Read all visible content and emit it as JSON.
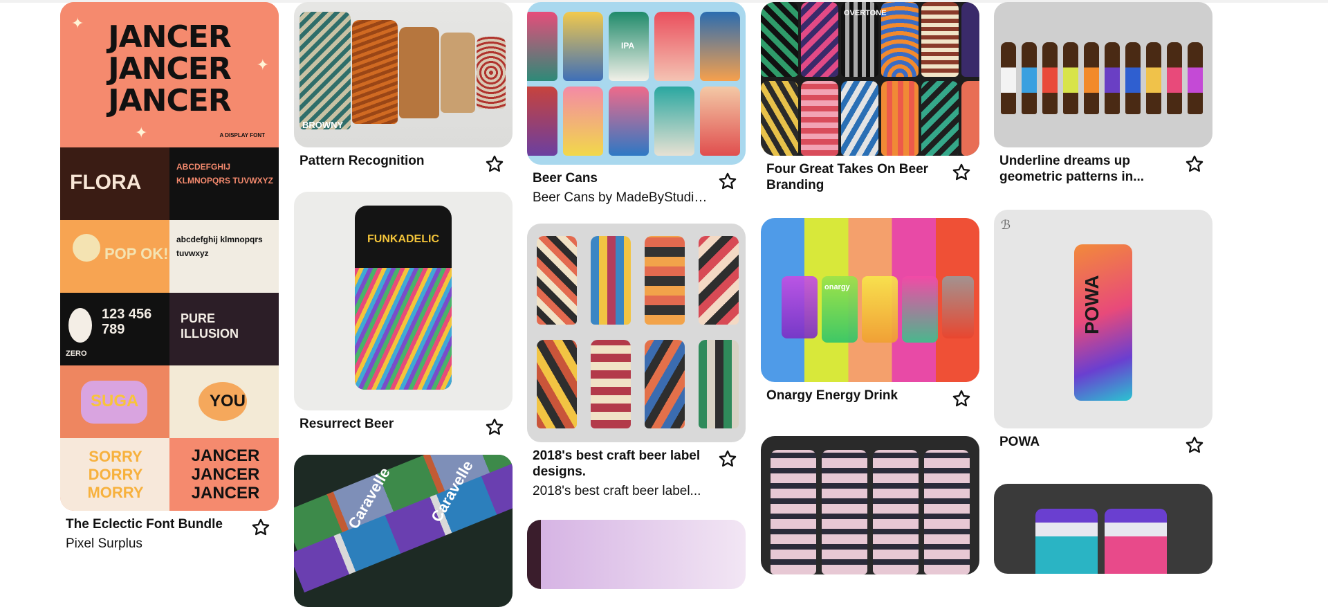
{
  "feed": {
    "columns": [
      {
        "pins": [
          {
            "title": "The Eclectic Font Bundle",
            "subtitle": "Pixel Surplus",
            "art": "font-bundle",
            "art_text": {
              "wordmark": "JANCER",
              "tagline": "A DISPLAY FONT",
              "tile_flora": "FLORA",
              "tile_alpha": "ABCDEFGHIJ KLMNOPQRS TUVWXYZ",
              "tile_pop": "POP OK!",
              "tile_lower": "abcdefghij klmnopqrs tuvwxyz",
              "tile_pure": "PURE ILLUSION",
              "tile_you": "YOU",
              "tile_sorry": "SORRY DORRY MORRY",
              "tile_zero": "ZERO"
            }
          }
        ]
      },
      {
        "pins": [
          {
            "title": "Pattern Recognition",
            "subtitle": "",
            "art": "pattern-cans",
            "art_text": {
              "can_label": "BROWNY"
            }
          },
          {
            "title": "Resurrect Beer",
            "subtitle": "",
            "art": "funkadelic-can",
            "art_text": {
              "can_label": "FUNKADELIC"
            }
          },
          {
            "title": "",
            "subtitle": "",
            "art": "caravelle-cans",
            "art_text": {
              "can_label": "Caravelle"
            }
          }
        ]
      },
      {
        "pins": [
          {
            "title": "Beer Cans",
            "subtitle": "Beer Cans by MadeByStudioJQ ...",
            "art": "colorful-cans",
            "art_text": {
              "can_label": "IPA"
            }
          },
          {
            "title": "2018's best craft beer label designs.",
            "subtitle": "2018's best craft beer label...",
            "art": "geometric-cans"
          },
          {
            "title": "",
            "subtitle": "",
            "art": "pink-gradient"
          }
        ]
      },
      {
        "pins": [
          {
            "title": "Four Great Takes On Beer Branding",
            "subtitle": "",
            "art": "overtone-cans",
            "art_text": {
              "can_label": "OVERTONE"
            }
          },
          {
            "title": "Onargy Energy Drink",
            "subtitle": "",
            "art": "onargy-glasses",
            "art_text": {
              "glass_label": "onargy"
            }
          },
          {
            "title": "",
            "subtitle": "",
            "art": "wave-cans"
          }
        ]
      },
      {
        "pins": [
          {
            "title": "Underline dreams up geometric patterns in...",
            "subtitle": "",
            "art": "bottles"
          },
          {
            "title": "POWA",
            "subtitle": "",
            "art": "powa-can",
            "art_text": {
              "can_label": "POWA"
            }
          },
          {
            "title": "",
            "subtitle": "",
            "art": "purple-cans"
          }
        ]
      }
    ]
  },
  "icons": {
    "save": "star-outline-icon"
  },
  "colors": {
    "text": "#111111",
    "star_stroke": "#111111",
    "background": "#ffffff"
  }
}
